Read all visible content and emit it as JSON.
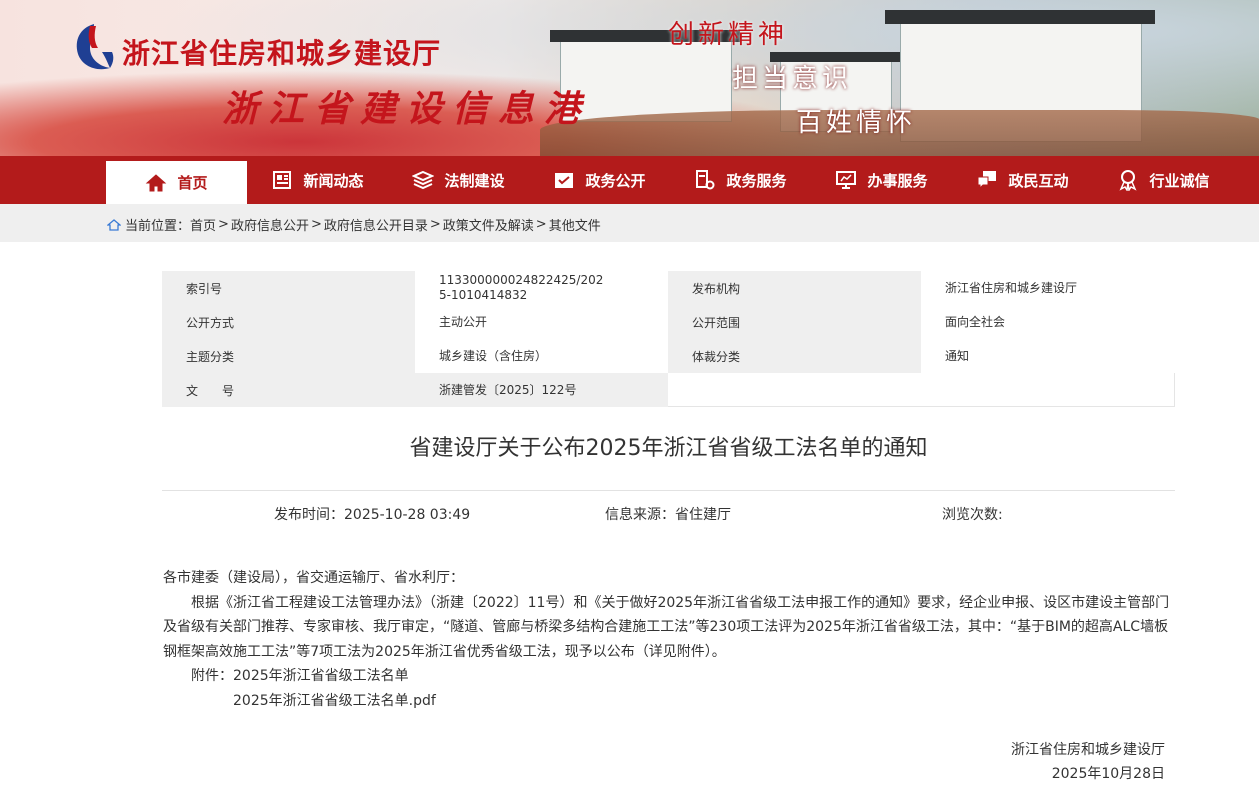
{
  "header": {
    "org_name": "浙江省住房和城乡建设厅",
    "site_name": "浙江省建设信息港",
    "slogans": [
      "创新精神",
      "担当意识",
      "百姓情怀"
    ]
  },
  "nav": {
    "items": [
      {
        "label": "首页",
        "icon": "home-icon"
      },
      {
        "label": "新闻动态",
        "icon": "newspaper-icon"
      },
      {
        "label": "法制建设",
        "icon": "layers-icon"
      },
      {
        "label": "政务公开",
        "icon": "open-affairs-icon"
      },
      {
        "label": "政务服务",
        "icon": "document-gear-icon"
      },
      {
        "label": "办事服务",
        "icon": "presentation-icon"
      },
      {
        "label": "政民互动",
        "icon": "chat-icon"
      },
      {
        "label": "行业诚信",
        "icon": "award-icon"
      }
    ]
  },
  "breadcrumb": {
    "prefix": "当前位置：",
    "items": [
      "首页",
      "政府信息公开",
      "政府信息公开目录",
      "政策文件及解读",
      "其他文件"
    ]
  },
  "meta": {
    "index_label": "索引号",
    "index_value": "113300000024822425/2025-1010414832",
    "publisher_label": "发布机构",
    "publisher_value": "浙江省住房和城乡建设厅",
    "disclosure_mode_label": "公开方式",
    "disclosure_mode_value": "主动公开",
    "disclosure_scope_label": "公开范围",
    "disclosure_scope_value": "面向全社会",
    "topic_label": "主题分类",
    "topic_value": "城乡建设（含住房）",
    "genre_label": "体裁分类",
    "genre_value": "通知",
    "doc_no_label": "文　　号",
    "doc_no_value": "浙建管发〔2025〕122号"
  },
  "article": {
    "title": "省建设厅关于公布2025年浙江省省级工法名单的通知",
    "publish_time_label": "发布时间：",
    "publish_time": "2025-10-28 03:49",
    "source_label": "信息来源：",
    "source": "省住建厅",
    "views_label": "浏览次数:",
    "salutation": "各市建委（建设局），省交通运输厅、省水利厅：",
    "paragraph": "根据《浙江省工程建设工法管理办法》（浙建〔2022〕11号）和《关于做好2025年浙江省省级工法申报工作的通知》要求，经企业申报、设区市建设主管部门及省级有关部门推荐、专家审核、我厅审定，“隧道、管廊与桥梁多结构合建施工工法”等230项工法评为2025年浙江省省级工法，其中：“基于BIM的超高ALC墙板钢框架高效施工工法”等7项工法为2025年浙江省优秀省级工法，现予以公布（详见附件）。",
    "attachment_label": "附件：",
    "attachment_title": "2025年浙江省省级工法名单",
    "attachment_file": "2025年浙江省省级工法名单.pdf",
    "signature_org": "浙江省住房和城乡建设厅",
    "signature_date": "2025年10月28日"
  },
  "colors": {
    "brand_red": "#b31b1b",
    "light_gray": "#efefef"
  }
}
